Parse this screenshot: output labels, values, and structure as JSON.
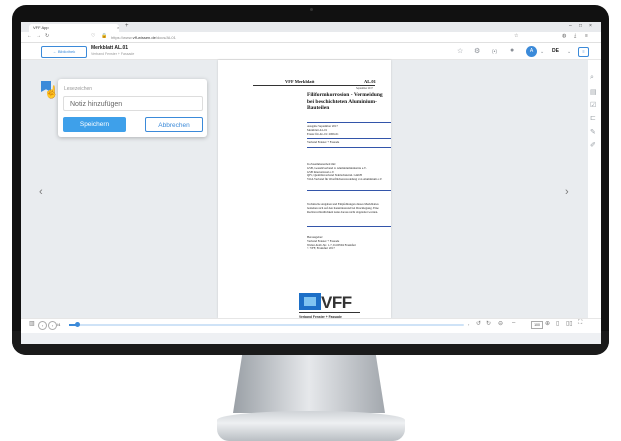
{
  "browser": {
    "tab_title": "VFF App",
    "tab_close": "×",
    "new_tab": "+",
    "url_prefix": "https://www.",
    "url_domain": "vff-wissen.de",
    "url_path": "/docs/AL01",
    "win_min": "–",
    "win_max": "□",
    "win_close": "×"
  },
  "toolbar": {
    "back_label": "← Bibliothek",
    "doc_title": "Merkblatt AL.01",
    "doc_subtitle": "Verband Fenster + Fassade",
    "avatar": "A",
    "language": "DE",
    "lang_box": "≡"
  },
  "popup": {
    "title": "Lesezeichen",
    "note_placeholder": "Notiz hinzufügen",
    "save": "Speichern",
    "cancel": "Abbrechen"
  },
  "viewer": {
    "prev_arrow": "‹",
    "next_arrow": "›"
  },
  "document": {
    "header_left": "VFF Merkblatt",
    "header_right": "AL.01",
    "date": "September 2017",
    "title": "Filiformkorrosion - Vermeidung bei beschichteten Aluminium-Bauteilen",
    "block1": "Ausgabe September 2017\nMerkblatt AL.01\nErsatz für AL.01: 2006-01",
    "block2": "Verband Fenster + Fassade",
    "block3": "In Zusammenarbeit mit:\nGSB, Gesamtverband d. Aluminiumindustrie e.V.\nGSB International e.V.\nQIV, Qualitätsverband Stahlschutzzul. GmbH\nVOA Verband für Oberflächenveredelung von Aluminium e.V.",
    "block4": "Technische Angaben und Empfehlungen dieses Merkblattes beziehen sich auf den Kenntnisstand bei Drucklegung. Eine Rechtsverbindlichkeit kann daraus nicht abgeleitet werden.",
    "block5": "Herausgeber:\nVerband Fenster + Fassade\nWalter-Kolb-Str. 1-7, D-60594 Frankfurt\n© VFF, Frankfurt 2017",
    "logo_text": "VFF",
    "logo_sub": "Verband Fenster + Fassade"
  },
  "bottombar": {
    "prev": "‹",
    "next": "›",
    "page_indicator": "/4",
    "progress": 0.02,
    "zoom": "100"
  },
  "colors": {
    "accent": "#3b8ad9",
    "save_button": "#3ea0ea",
    "logo_blue": "#1c6fc7"
  }
}
